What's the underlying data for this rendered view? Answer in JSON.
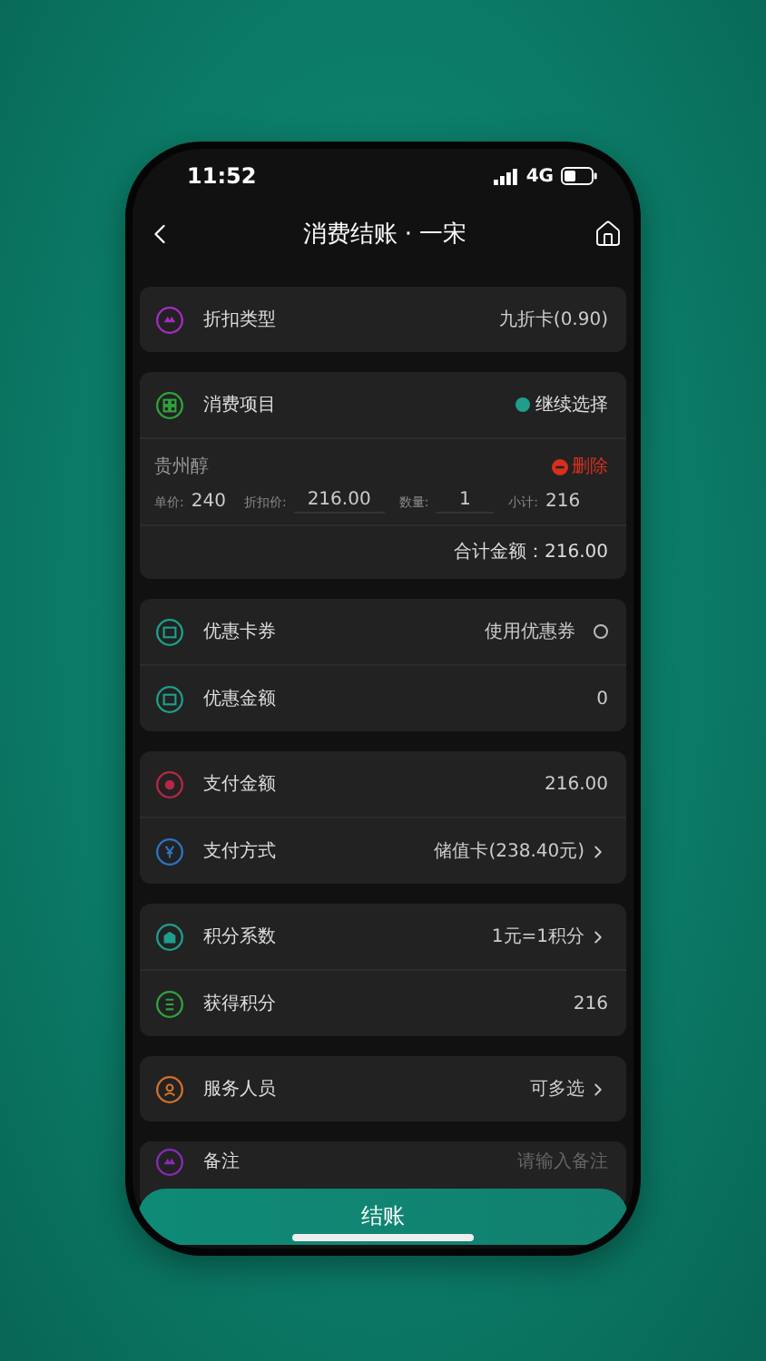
{
  "status_bar": {
    "time": "11:52",
    "network": "4G"
  },
  "nav": {
    "title": "消费结账 · 一宋"
  },
  "sections": [
    {
      "kind": "rows",
      "rows": [
        {
          "label": "折扣类型",
          "value": "九折卡(0.90)",
          "color": "#a52bc4"
        }
      ]
    },
    {
      "kind": "items",
      "header": {
        "label": "消费项目",
        "action": "继续选择",
        "color": "#2fa23e"
      },
      "items": [
        {
          "name": "贵州醇",
          "delete": "删除",
          "unit_label": "单价:",
          "unit": "240",
          "discount_label": "折扣价:",
          "discount": "216.00",
          "qty_label": "数量:",
          "qty": "1",
          "subtotal_label": "小计:",
          "subtotal": "216"
        }
      ],
      "total": "合计金额：216.00"
    },
    {
      "kind": "rows",
      "rows": [
        {
          "label": "优惠卡券",
          "value": "使用优惠券",
          "color": "#1f9e8c",
          "radio": {
            "checked": false
          }
        },
        {
          "label": "优惠金额",
          "value": "0",
          "color": "#1f9e8c"
        }
      ]
    },
    {
      "kind": "rows",
      "rows": [
        {
          "label": "支付金额",
          "value": "216.00",
          "color": "#b82646"
        },
        {
          "label": "支付方式",
          "value": "储值卡(238.40元)",
          "color": "#2b74c4",
          "chevron": true
        }
      ]
    },
    {
      "kind": "rows",
      "rows": [
        {
          "label": "积分系数",
          "value": "1元=1积分",
          "color": "#1f9e8c",
          "chevron": true
        },
        {
          "label": "获得积分",
          "value": "216",
          "color": "#2fa23e"
        }
      ]
    },
    {
      "kind": "rows",
      "rows": [
        {
          "label": "服务人员",
          "value": "可多选",
          "color": "#d2702a",
          "chevron": true
        }
      ]
    },
    {
      "kind": "rows",
      "rows": [
        {
          "label": "备注",
          "placeholder": "请输入备注",
          "color": "#8a2ab8"
        }
      ]
    }
  ],
  "checkout_button": "结账"
}
